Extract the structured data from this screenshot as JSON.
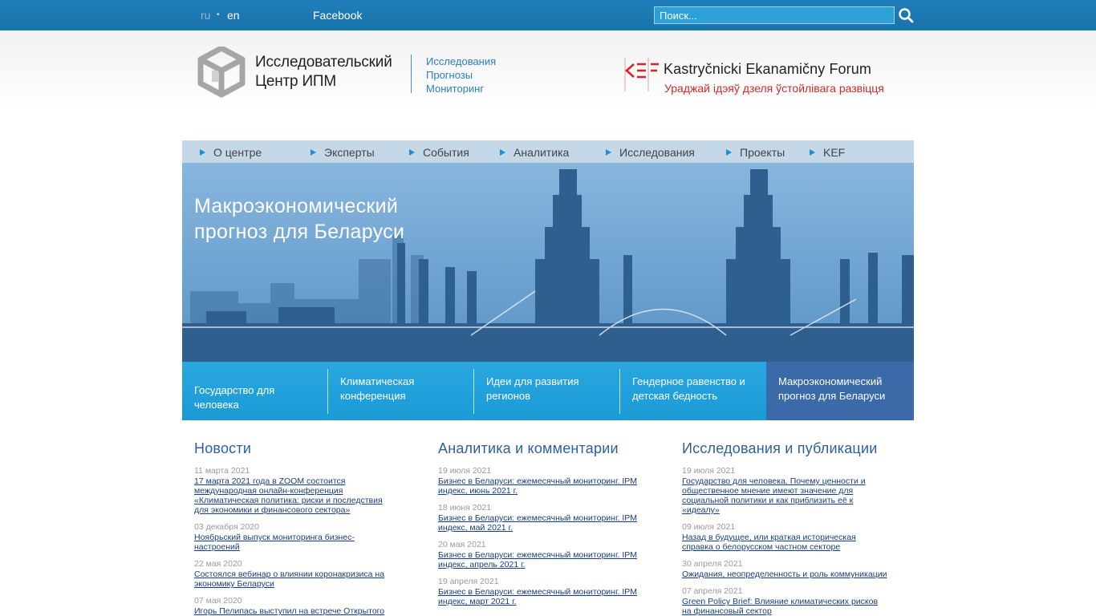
{
  "topbar": {
    "lang_ru": "ru",
    "lang_sep": "•",
    "lang_en": "en",
    "facebook": "Facebook",
    "search_placeholder": "Поиск..."
  },
  "header": {
    "logo_line1": "Исследовательский",
    "logo_line2": "Центр ИПМ",
    "tag1": "Исследования",
    "tag2": "Прогнозы",
    "tag3": "Мониторинг",
    "kef_title": "Kastryčnicki Ekanamičny Forum",
    "kef_subtitle": "Ураджай ідэяў дзеля ўстойлівага развіцця"
  },
  "nav": {
    "items": [
      "О центре",
      "Эксперты",
      "События",
      "Аналитика",
      "Исследования",
      "Проекты",
      "KEF"
    ]
  },
  "hero": {
    "title_line1": "Макроэкономический",
    "title_line2": "прогноз для Беларуси"
  },
  "tiles": [
    {
      "line1": "Государство для человека",
      "line2": ""
    },
    {
      "line1": "Климатическая",
      "line2": "конференция"
    },
    {
      "line1": "Идеи для развития",
      "line2": "регионов"
    },
    {
      "line1": "Гендерное равенство и",
      "line2": "детская бедность"
    },
    {
      "line1": "Макроэкономический",
      "line2": "прогноз для Беларуси"
    }
  ],
  "columns": [
    {
      "title": "Новости",
      "entries": [
        {
          "date": "11 марта 2021",
          "lines": [
            "17 марта 2021 года в ZOOM состоится",
            "международная онлайн-конференция",
            "«Климатическая политика: риски и последствия",
            "для экономики и финансового сектора»"
          ]
        },
        {
          "date": "03 декабря 2020",
          "lines": [
            "Ноябрьский выпуск мониторинга бизнес-",
            "настроений"
          ]
        },
        {
          "date": "22 мая 2020",
          "lines": [
            "Состоялся вебинар о влиянии коронакризиса на",
            "экономику Беларуси"
          ]
        },
        {
          "date": "07 мая 2020",
          "lines": [
            "Игорь Пелипась выступил на встрече Открытого"
          ]
        }
      ]
    },
    {
      "title": "Аналитика и комментарии",
      "entries": [
        {
          "date": "19 июля 2021",
          "lines": [
            "Бизнес в Беларуси: ежемесячный мониторинг. IPM",
            "индекс, июнь 2021 г."
          ]
        },
        {
          "date": "18 июня 2021",
          "lines": [
            "Бизнес в Беларуси: ежемесячный мониторинг. IPM",
            "индекс, май 2021 г."
          ]
        },
        {
          "date": "20 мая 2021",
          "lines": [
            "Бизнес в Беларуси: ежемесячный мониторинг. IPM",
            "индекс, апрель 2021 г."
          ]
        },
        {
          "date": "19 апреля 2021",
          "lines": [
            "Бизнес в Беларуси: ежемесячный мониторинг. IPM",
            "индекс, март 2021 г."
          ]
        }
      ]
    },
    {
      "title": "Исследования и публикации",
      "entries": [
        {
          "date": "19 июля 2021",
          "lines": [
            "Государство для человека. Почему ценности и",
            "общественное мнение имеют значение для",
            "социальной политики и как приблизить её к",
            "«идеалу»"
          ]
        },
        {
          "date": "09 июля 2021",
          "lines": [
            "Назад в будущее, или краткая историческая",
            "справка о белорусском частном секторе"
          ]
        },
        {
          "date": "30 апреля 2021",
          "lines": [
            "Ожидания, неопределенность и роль коммуникации"
          ]
        },
        {
          "date": "07 апреля 2021",
          "lines": [
            "Green Policy Brief: Влияние климатических рисков",
            "на финансовый сектор"
          ]
        }
      ]
    }
  ],
  "colors": {
    "topbar": "#1f7fba",
    "accent_blue": "#2b7fc0",
    "kef_red": "#d4282d",
    "tile_blue": "#1b9ad6",
    "tile_active": "#3a6aa8",
    "link": "#1a3f7a"
  }
}
